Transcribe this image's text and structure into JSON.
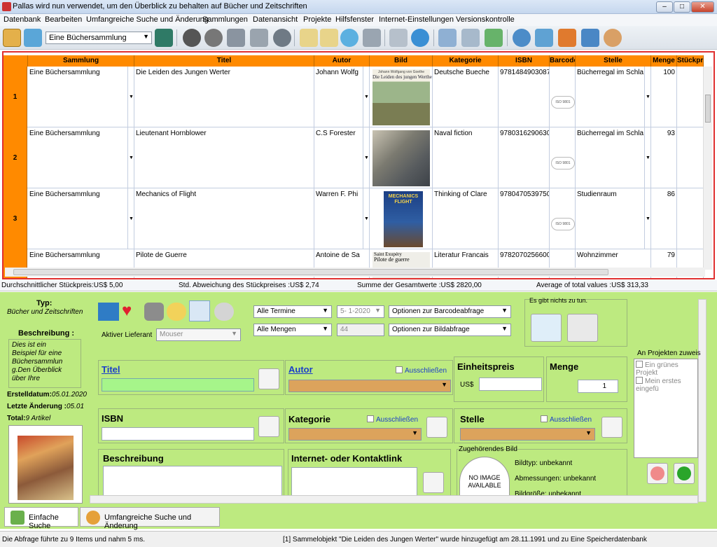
{
  "window": {
    "title": "Pallas wird nun verwendet, um den Überblick zu behalten auf Bücher und Zeitschriften",
    "btn_min": "–",
    "btn_max": "□",
    "btn_close": "✕"
  },
  "menu": [
    "Datenbank",
    "Bearbeiten",
    "Umfangreiche Suche und Änderung",
    "Sammlungen",
    "Datenansicht",
    "Projekte",
    "Hilfsfenster",
    "Internet-Einstellungen",
    "Versionskontrolle"
  ],
  "toolbar": {
    "collection_select": "Eine Büchersammlung"
  },
  "grid": {
    "headers": [
      "Sammlung",
      "Titel",
      "Autor",
      "Bild",
      "Kategorie",
      "ISBN",
      "Barcode",
      "Stelle",
      "Menge",
      "Stückpre"
    ],
    "rows": [
      {
        "num": "1",
        "sammlung": "Eine Büchersammlung",
        "titel": "Die Leiden des Jungen Werter",
        "autor": "Johann Wolfg",
        "kategorie": "Deutsche Bueche",
        "isbn": "9781484903087",
        "stelle": "Bücherregal im Schla",
        "menge": "100",
        "cover_title": "Die Leiden des jungen Werther",
        "cover_author": "Johann Wolfgang von Goethe"
      },
      {
        "num": "2",
        "sammlung": "Eine Büchersammlung",
        "titel": "Lieutenant Hornblower",
        "autor": "C.S Forester",
        "kategorie": "Naval fiction",
        "isbn": "9780316290630",
        "stelle": "Bücherregal im Schla",
        "menge": "93",
        "cover_title": "",
        "cover_author": ""
      },
      {
        "num": "3",
        "sammlung": "Eine Büchersammlung",
        "titel": "Mechanics of Flight",
        "autor": "Warren F. Phi",
        "kategorie": "Thinking of Clare",
        "isbn": "9780470539750",
        "stelle": "Studienraum",
        "menge": "86",
        "cover_title": "MECHANICS FLIGHT",
        "cover_author": ""
      },
      {
        "num": "",
        "sammlung": "Eine Büchersammlung",
        "titel": "Pilote de Guerre",
        "autor": "Antoine de Sa",
        "kategorie": "Literatur Francais",
        "isbn": "9782070256600",
        "stelle": "Wohnzimmer",
        "menge": "79",
        "cover_title": "Pilote de guerre",
        "cover_author": "Saint Exupéry"
      }
    ],
    "barcode_text": "ISO 9801"
  },
  "stats": {
    "avg": "Durchschnittlicher Stückpreis:US$ 5,00",
    "std": "Std. Abweichung des Stückpreises :US$ 2,74",
    "sum": "Summe der Gesamtwerte :US$ 2820,00",
    "avg_total": "Average of total values :US$ 313,33"
  },
  "left": {
    "typ_label": "Typ:",
    "typ_value": "Bücher und Zeitschriften",
    "beschreibung_label": "Beschreibung :",
    "beschreibung_text": "Dies ist ein Beispiel für eine Büchersammlun g.Den Überblick über Ihre",
    "erstell_label": "Erstelldatum:",
    "erstell_value": "05.01.2020",
    "letzte_label": "Letzte Änderung :",
    "letzte_value": "05.01",
    "total_label": "Total:",
    "total_value": "9 Artikel"
  },
  "filters": {
    "termine": "Alle Termine",
    "date": "5- 1-2020",
    "barcode": "Optionen zur Barcodeabfrage",
    "mengen": "Alle Mengen",
    "qty": "44",
    "bild": "Optionen zur Bildabfrage",
    "lieferant_label": "Aktiver Lieferant",
    "lieferant": "Mouser",
    "no_data_label": "Es gibt nichts zu tun."
  },
  "form": {
    "titel": "Titel",
    "autor": "Autor",
    "ausschliessen": "Ausschließen",
    "einheitspreis": "Einheitspreis",
    "currency": "US$",
    "menge": "Menge",
    "menge_value": "1",
    "isbn": "ISBN",
    "kategorie": "Kategorie",
    "stelle": "Stelle",
    "beschreibung": "Beschreibung",
    "internet": "Internet- oder Kontaktlink",
    "bild_label": "Zugehörendes Bild",
    "no_image": "NO IMAGE AVAILABLE",
    "bildtyp": "Bildtyp: unbekannt",
    "abmessungen": "Abmessungen: unbekannt",
    "bildgroesse": "Bildgröße: unbekannt"
  },
  "projects": {
    "label": "An Projekten zuweis",
    "items": [
      "Ein grünes Projekt",
      "Mein erstes eingefü"
    ]
  },
  "tabs": {
    "einfach": "Einfache Suche",
    "umfangreich": "Umfangreiche Suche und Änderung"
  },
  "status": {
    "left": "Die Abfrage führte zu 9 Items und nahm 5 ms.",
    "right": "[1] Sammelobjekt \"Die Leiden des Jungen Werter\" wurde hinzugefügt am 28.11.1991 und zu Eine Speicherdatenbank"
  },
  "colors": {
    "header_orange": "#ff8a00",
    "panel_green": "#bdea80",
    "selection_border": "#e03030",
    "title_green": "#a6f58a",
    "autor_field": "#dca35c"
  }
}
